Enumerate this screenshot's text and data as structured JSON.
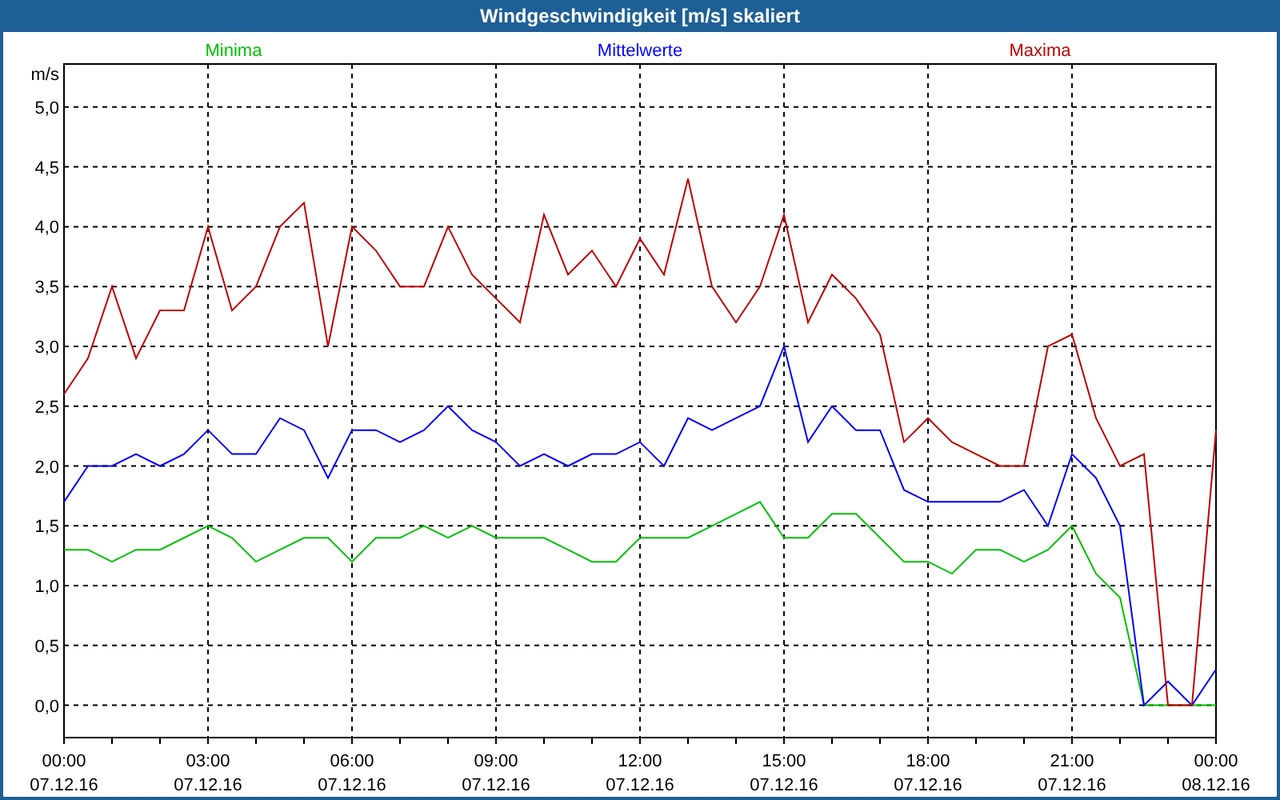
{
  "window": {
    "title": "Windgeschwindigkeit [m/s] skaliert"
  },
  "chart_data": {
    "type": "line",
    "grid": true,
    "ylabel": "m/s",
    "ylim": [
      -0.27,
      5.36
    ],
    "categories": [
      "00:00\n07.12.16",
      null,
      null,
      null,
      null,
      null,
      "03:00\n07.12.16",
      null,
      null,
      null,
      null,
      null,
      "06:00\n07.12.16",
      null,
      null,
      null,
      null,
      null,
      "09:00\n07.12.16",
      null,
      null,
      null,
      null,
      null,
      "12:00\n07.12.16",
      null,
      null,
      null,
      null,
      null,
      "15:00\n07.12.16",
      null,
      null,
      null,
      null,
      null,
      "18:00\n07.12.16",
      null,
      null,
      null,
      null,
      null,
      "21:00\n07.12.16",
      null,
      null,
      null,
      null,
      null,
      "00:00\n08.12.16"
    ],
    "series": [
      {
        "name": "Minima",
        "color": "#00c000",
        "values": [
          1.3,
          1.3,
          1.2,
          1.3,
          1.3,
          1.4,
          1.5,
          1.4,
          1.2,
          1.3,
          1.4,
          1.4,
          1.2,
          1.4,
          1.4,
          1.5,
          1.4,
          1.5,
          1.4,
          1.4,
          1.4,
          1.3,
          1.2,
          1.2,
          1.4,
          1.4,
          1.4,
          1.5,
          1.6,
          1.7,
          1.4,
          1.4,
          1.6,
          1.6,
          1.4,
          1.2,
          1.2,
          1.1,
          1.3,
          1.3,
          1.2,
          1.3,
          1.5,
          1.1,
          0.9,
          0,
          0,
          0,
          0
        ]
      },
      {
        "name": "Mittelwerte",
        "color": "#0000ff",
        "values": [
          1.7,
          2.0,
          2.0,
          2.1,
          2.0,
          2.1,
          2.3,
          2.1,
          2.1,
          2.4,
          2.3,
          1.9,
          2.3,
          2.3,
          2.2,
          2.3,
          2.5,
          2.3,
          2.2,
          2.0,
          2.1,
          2.0,
          2.1,
          2.1,
          2.2,
          2.0,
          2.4,
          2.3,
          2.4,
          2.5,
          3.0,
          2.2,
          2.5,
          2.3,
          2.3,
          1.8,
          1.7,
          1.7,
          1.7,
          1.7,
          1.8,
          1.5,
          2.1,
          1.9,
          1.5,
          0,
          0.2,
          0,
          0.3
        ]
      },
      {
        "name": "Maxima",
        "color": "#c00000",
        "values": [
          2.6,
          2.9,
          3.5,
          2.9,
          3.3,
          3.3,
          4.0,
          3.3,
          3.5,
          4.0,
          4.2,
          3.0,
          4.0,
          3.8,
          3.5,
          3.5,
          4.0,
          3.6,
          3.4,
          3.2,
          4.1,
          3.6,
          3.8,
          3.5,
          3.9,
          3.6,
          4.4,
          3.5,
          3.2,
          3.5,
          4.1,
          3.2,
          3.6,
          3.4,
          3.1,
          2.2,
          2.4,
          2.2,
          2.1,
          2.0,
          2.0,
          3.0,
          3.1,
          2.4,
          2.0,
          2.1,
          0,
          0,
          2.3
        ]
      }
    ],
    "yticks": [
      {
        "value": 0,
        "label": "0,0"
      },
      {
        "value": 0.5,
        "label": "0,5"
      },
      {
        "value": 1,
        "label": "1,0"
      },
      {
        "value": 1.5,
        "label": "1,5"
      },
      {
        "value": 2,
        "label": "2,0"
      },
      {
        "value": 2.5,
        "label": "2,5"
      },
      {
        "value": 3,
        "label": "3,0"
      },
      {
        "value": 3.5,
        "label": "3,5"
      },
      {
        "value": 4,
        "label": "4,0"
      },
      {
        "value": 4.5,
        "label": "4,5"
      },
      {
        "value": 5,
        "label": "5,0"
      }
    ]
  }
}
